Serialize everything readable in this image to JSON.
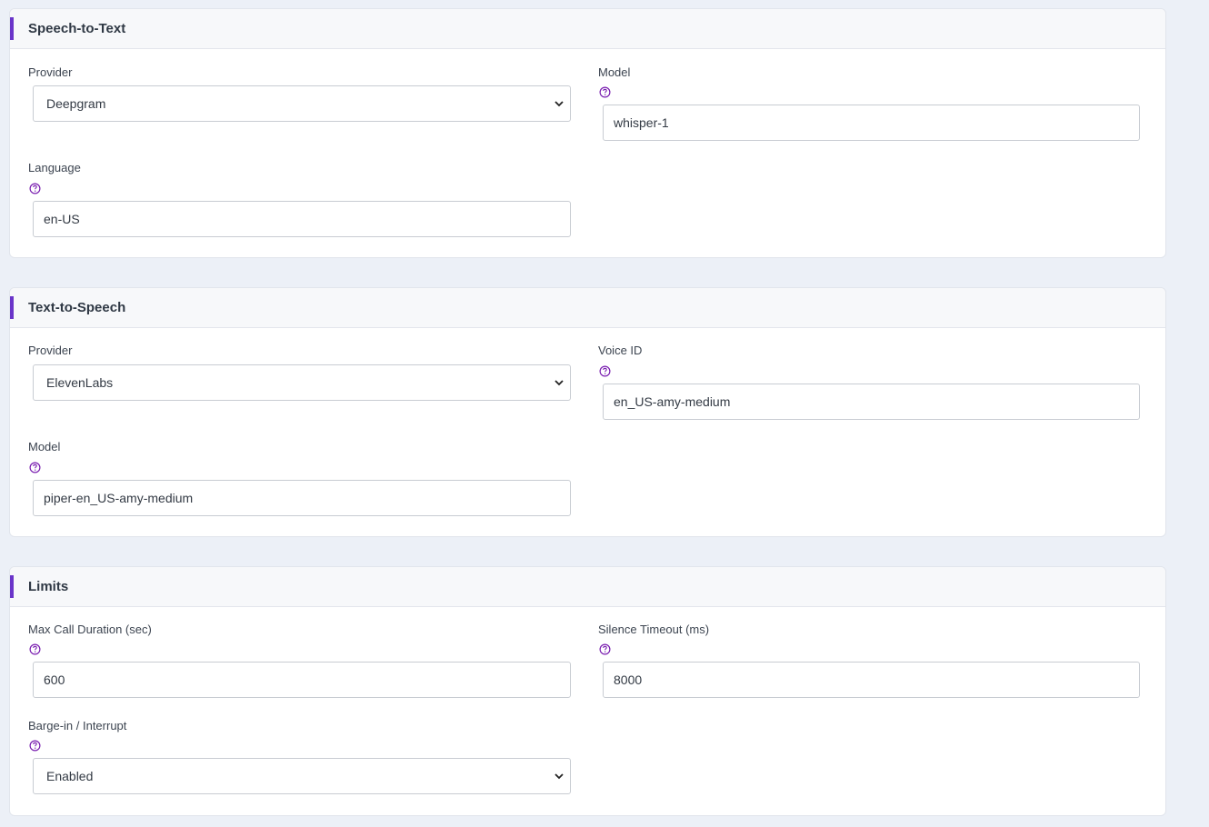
{
  "colors": {
    "accent": "#6a35c9",
    "help_icon": "#7a1fb0",
    "background": "#ecf0f7"
  },
  "stt": {
    "title": "Speech-to-Text",
    "provider": {
      "label": "Provider",
      "value": "Deepgram"
    },
    "model": {
      "label": "Model",
      "value": "whisper-1",
      "icon": "help-circle-icon"
    },
    "language": {
      "label": "Language",
      "value": "en-US",
      "icon": "help-circle-icon"
    }
  },
  "tts": {
    "title": "Text-to-Speech",
    "provider": {
      "label": "Provider",
      "value": "ElevenLabs"
    },
    "voice_id": {
      "label": "Voice ID",
      "value": "en_US-amy-medium",
      "icon": "help-circle-icon"
    },
    "model": {
      "label": "Model",
      "value": "piper-en_US-amy-medium",
      "icon": "help-circle-icon"
    }
  },
  "limits": {
    "title": "Limits",
    "max_call_duration": {
      "label": "Max Call Duration (sec)",
      "value": "600",
      "icon": "help-circle-icon"
    },
    "silence_timeout": {
      "label": "Silence Timeout (ms)",
      "value": "8000",
      "icon": "help-circle-icon"
    },
    "barge_in": {
      "label": "Barge-in / Interrupt",
      "value": "Enabled",
      "icon": "help-circle-icon"
    }
  }
}
